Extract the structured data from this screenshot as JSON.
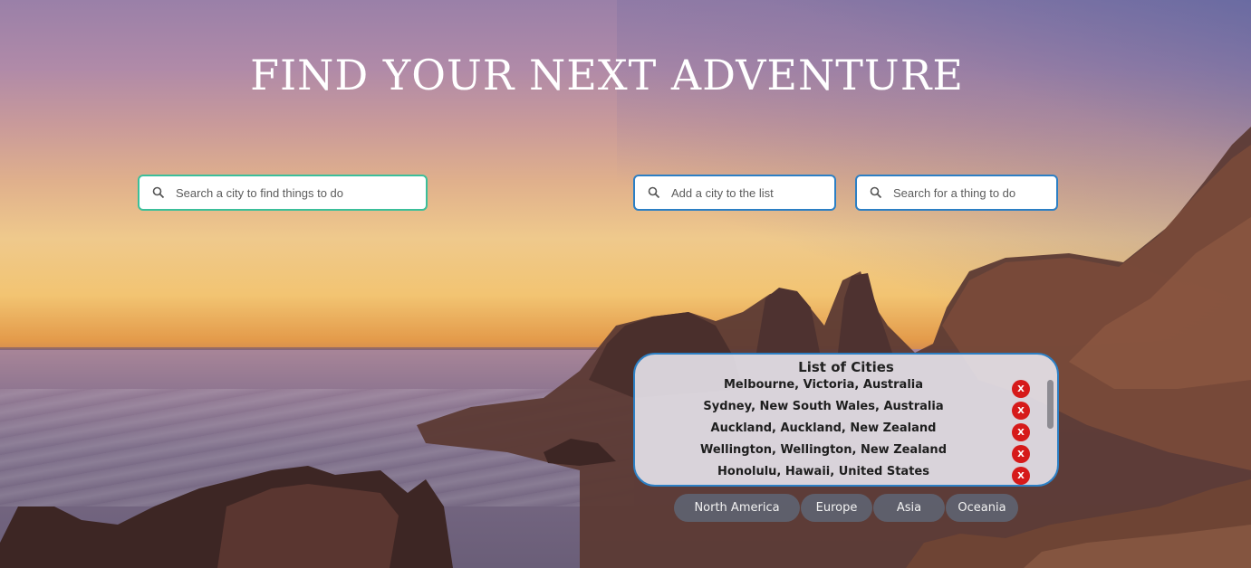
{
  "title": "FIND YOUR NEXT ADVENTURE",
  "search": {
    "city_things_placeholder": "Search a city to find things to do",
    "add_city_placeholder": "Add a city to the list",
    "thing_placeholder": "Search for a thing to do"
  },
  "city_list": {
    "heading": "List of Cities",
    "remove_label": "X",
    "cities": [
      "Melbourne, Victoria, Australia",
      "Sydney, New South Wales, Australia",
      "Auckland, Auckland, New Zealand",
      "Wellington, Wellington, New Zealand",
      "Honolulu, Hawaii, United States"
    ]
  },
  "regions": [
    "North America",
    "Europe",
    "Asia",
    "Oceania"
  ],
  "colors": {
    "accent_green": "#3bbf9a",
    "accent_blue": "#2c7fc4",
    "remove_red": "#d61a1a"
  },
  "icons": {
    "search": "search-icon",
    "remove": "close-icon"
  }
}
